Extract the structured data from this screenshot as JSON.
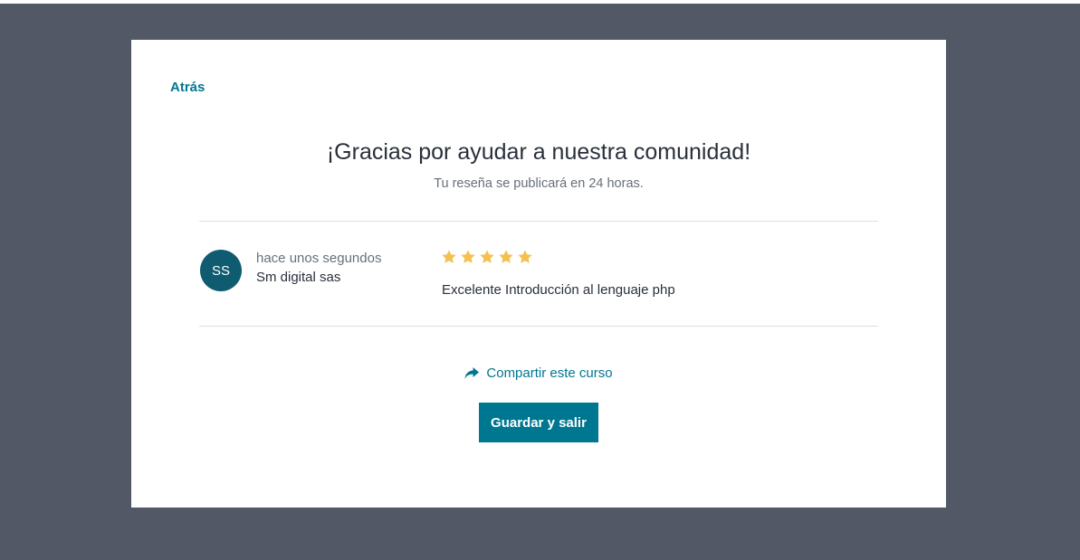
{
  "nav": {
    "back_label": "Atrás"
  },
  "header": {
    "title": "¡Gracias por ayudar a nuestra comunidad!",
    "subtitle": "Tu reseña se publicará en 24 horas."
  },
  "review": {
    "avatar_initials": "SS",
    "time": "hace unos segundos",
    "author": "Sm digital sas",
    "rating": 5,
    "rating_max": 5,
    "text": "Excelente Introducción al lenguaje php"
  },
  "actions": {
    "share_label": "Compartir este curso",
    "share_icon": "share-arrow-icon",
    "save_label": "Guardar y salir"
  },
  "colors": {
    "backdrop": "#525865",
    "accent": "#007791",
    "avatar_bg": "#0f5b70",
    "star": "#f4c150",
    "text_dark": "#29303b",
    "text_muted": "#686f7a"
  }
}
